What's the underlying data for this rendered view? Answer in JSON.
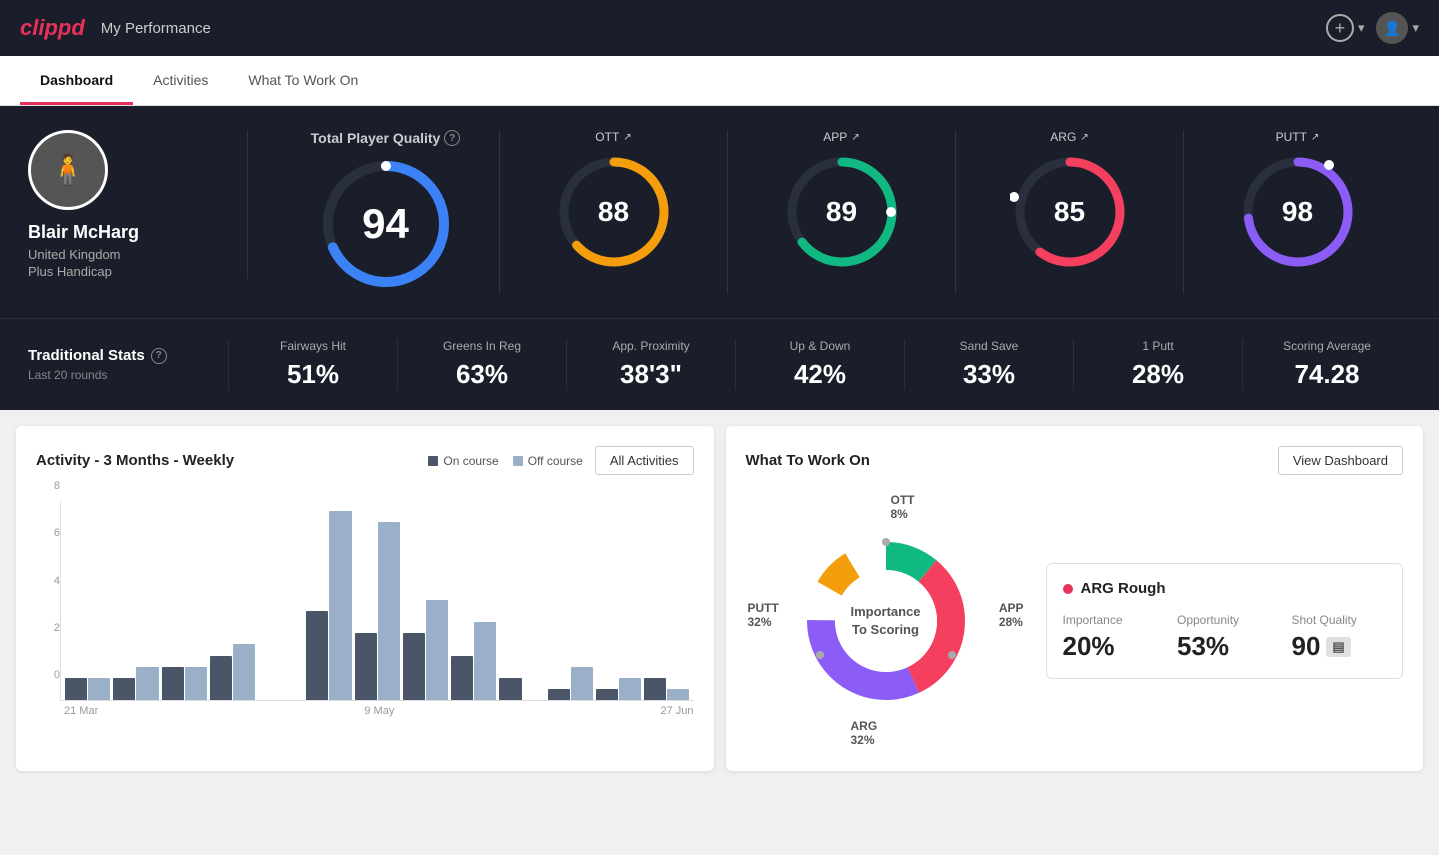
{
  "header": {
    "logo": "clippd",
    "title": "My Performance",
    "add_label": "+",
    "chevron": "▾"
  },
  "nav": {
    "tabs": [
      {
        "id": "dashboard",
        "label": "Dashboard",
        "active": true
      },
      {
        "id": "activities",
        "label": "Activities",
        "active": false
      },
      {
        "id": "what-to-work-on",
        "label": "What To Work On",
        "active": false
      }
    ]
  },
  "player": {
    "name": "Blair McHarg",
    "country": "United Kingdom",
    "handicap": "Plus Handicap"
  },
  "gauges": {
    "total": {
      "label": "Total Player Quality",
      "value": 94,
      "color": "#3b82f6"
    },
    "items": [
      {
        "id": "ott",
        "label": "OTT",
        "value": 88,
        "color": "#f59e0b"
      },
      {
        "id": "app",
        "label": "APP",
        "value": 89,
        "color": "#10b981"
      },
      {
        "id": "arg",
        "label": "ARG",
        "value": 85,
        "color": "#f43f5e"
      },
      {
        "id": "putt",
        "label": "PUTT",
        "value": 98,
        "color": "#8b5cf6"
      }
    ]
  },
  "traditional_stats": {
    "title": "Traditional Stats",
    "subtitle": "Last 20 rounds",
    "items": [
      {
        "label": "Fairways Hit",
        "value": "51%"
      },
      {
        "label": "Greens In Reg",
        "value": "63%"
      },
      {
        "label": "App. Proximity",
        "value": "38'3\""
      },
      {
        "label": "Up & Down",
        "value": "42%"
      },
      {
        "label": "Sand Save",
        "value": "33%"
      },
      {
        "label": "1 Putt",
        "value": "28%"
      },
      {
        "label": "Scoring Average",
        "value": "74.28"
      }
    ]
  },
  "activity_chart": {
    "title": "Activity - 3 Months - Weekly",
    "legend": {
      "on_course": "On course",
      "off_course": "Off course"
    },
    "all_activities_btn": "All Activities",
    "y_labels": [
      "8",
      "6",
      "4",
      "2",
      "0"
    ],
    "x_labels": [
      "21 Mar",
      "9 May",
      "27 Jun"
    ],
    "bars": [
      {
        "on": 1,
        "off": 1
      },
      {
        "on": 1,
        "off": 1.5
      },
      {
        "on": 1.5,
        "off": 1.5
      },
      {
        "on": 2,
        "off": 2.5
      },
      {
        "on": 0,
        "off": 0
      },
      {
        "on": 4,
        "off": 8.5
      },
      {
        "on": 3,
        "off": 8
      },
      {
        "on": 3,
        "off": 4.5
      },
      {
        "on": 2,
        "off": 3.5
      },
      {
        "on": 1,
        "off": 0
      },
      {
        "on": 0.5,
        "off": 1.5
      },
      {
        "on": 0.5,
        "off": 1
      },
      {
        "on": 1,
        "off": 0.5
      }
    ]
  },
  "what_to_work_on": {
    "title": "What To Work On",
    "view_dashboard_btn": "View Dashboard",
    "donut_center_line1": "Importance",
    "donut_center_line2": "To Scoring",
    "segments": [
      {
        "label": "OTT",
        "pct": "8%",
        "color": "#f59e0b",
        "degrees": 29
      },
      {
        "label": "APP",
        "pct": "28%",
        "color": "#10b981",
        "degrees": 101
      },
      {
        "label": "ARG",
        "pct": "32%",
        "color": "#f43f5e",
        "degrees": 115
      },
      {
        "label": "PUTT",
        "pct": "32%",
        "color": "#8b5cf6",
        "degrees": 115
      }
    ],
    "info_card": {
      "title": "ARG Rough",
      "metrics": [
        {
          "label": "Importance",
          "value": "20%"
        },
        {
          "label": "Opportunity",
          "value": "53%"
        },
        {
          "label": "Shot Quality",
          "value": "90",
          "badge": true
        }
      ]
    }
  }
}
